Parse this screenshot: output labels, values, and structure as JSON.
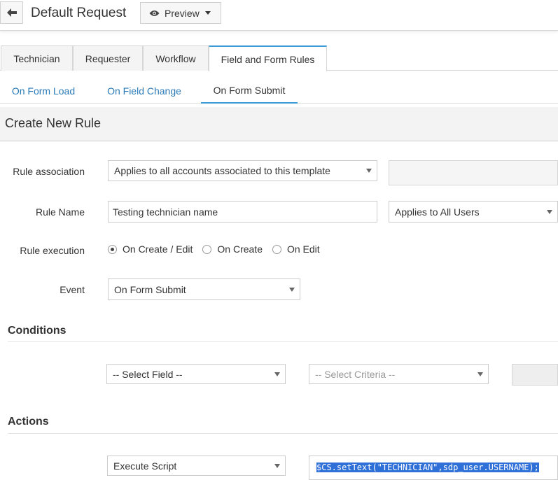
{
  "header": {
    "title": "Default Request",
    "preview_label": "Preview"
  },
  "tabs": [
    {
      "label": "Technician"
    },
    {
      "label": "Requester"
    },
    {
      "label": "Workflow"
    },
    {
      "label": "Field and Form Rules",
      "active": true
    }
  ],
  "subtabs": [
    {
      "label": "On Form Load"
    },
    {
      "label": "On Field Change"
    },
    {
      "label": "On Form Submit",
      "active": true
    }
  ],
  "section_title": "Create New Rule",
  "form": {
    "rule_association": {
      "label": "Rule association",
      "value": "Applies to all accounts associated to this template"
    },
    "rule_name": {
      "label": "Rule Name",
      "value": "Testing technician name",
      "users_value": "Applies to All Users"
    },
    "rule_execution": {
      "label": "Rule execution",
      "options": [
        "On Create / Edit",
        "On Create",
        "On Edit"
      ],
      "selected": "On Create / Edit"
    },
    "event": {
      "label": "Event",
      "value": "On Form Submit"
    }
  },
  "conditions": {
    "title": "Conditions",
    "field_placeholder": "-- Select Field --",
    "criteria_placeholder": "-- Select Criteria --"
  },
  "actions": {
    "title": "Actions",
    "action_value": "Execute Script",
    "script": "$CS.setText(\"TECHNICIAN\",sdp_user.USERNAME);"
  },
  "colors": {
    "accent": "#3a9bd5",
    "link": "#2a7ab8",
    "selection": "#2f6fd8"
  }
}
